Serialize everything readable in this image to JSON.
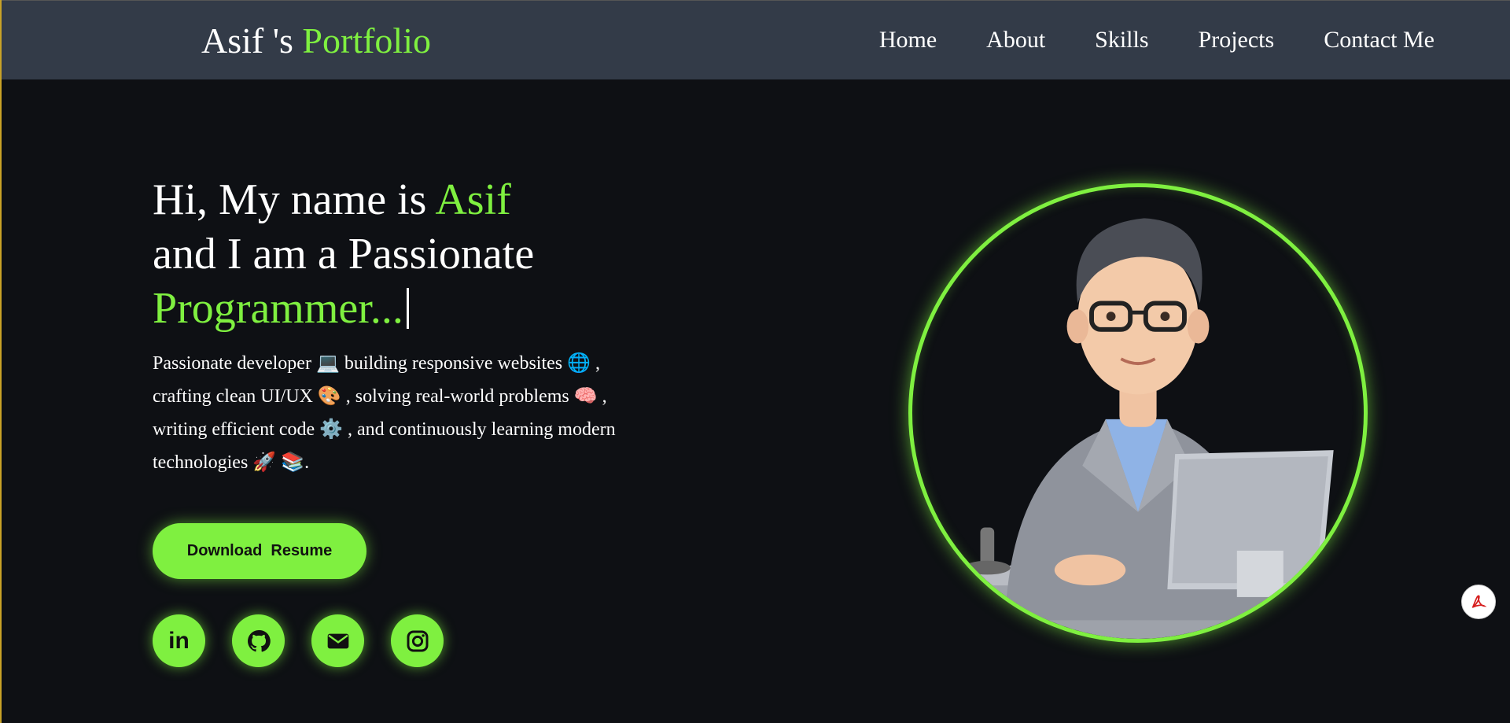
{
  "brand": {
    "prefix": "Asif 's ",
    "accent": "Portfolio"
  },
  "nav": [
    {
      "label": "Home"
    },
    {
      "label": "About"
    },
    {
      "label": "Skills"
    },
    {
      "label": "Projects"
    },
    {
      "label": "Contact Me"
    }
  ],
  "hero": {
    "line1_prefix": "Hi, My name is ",
    "line1_name": "Asif",
    "line2": "and I am a Passionate",
    "line3_role": "Programmer...",
    "description": "Passionate developer 💻  building responsive websites 🌐 , crafting clean UI/UX 🎨 , solving real-world problems 🧠 , writing efficient code ⚙️ , and continuously learning modern technologies 🚀 📚.",
    "resume_button": "Download  Resume"
  },
  "social_icons": [
    "linkedin-icon",
    "github-icon",
    "envelope-icon",
    "instagram-icon"
  ],
  "colors": {
    "accent": "#7ff040",
    "navbar_bg": "#333b48",
    "page_bg": "#0e1014"
  }
}
